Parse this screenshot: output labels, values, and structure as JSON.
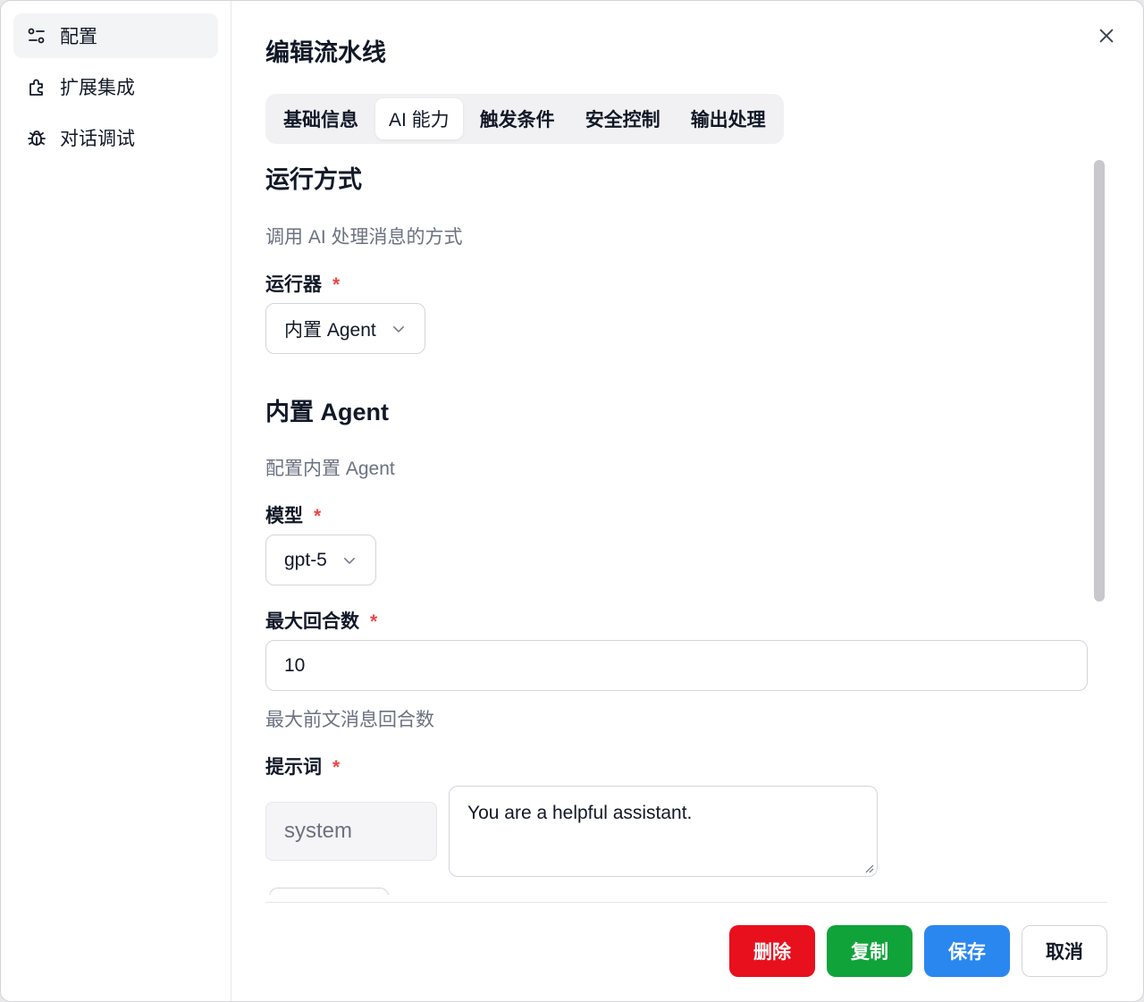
{
  "sidebar": {
    "items": [
      {
        "label": "配置",
        "icon": "settings-sliders-icon",
        "active": true
      },
      {
        "label": "扩展集成",
        "icon": "puzzle-icon",
        "active": false
      },
      {
        "label": "对话调试",
        "icon": "bug-icon",
        "active": false
      }
    ]
  },
  "dialog": {
    "title": "编辑流水线",
    "close_icon": "close-icon"
  },
  "tabs": [
    {
      "label": "基础信息",
      "active": false
    },
    {
      "label": "AI 能力",
      "active": true
    },
    {
      "label": "触发条件",
      "active": false
    },
    {
      "label": "安全控制",
      "active": false
    },
    {
      "label": "输出处理",
      "active": false
    }
  ],
  "run_mode": {
    "title": "运行方式",
    "desc": "调用 AI 处理消息的方式",
    "runner_label": "运行器",
    "runner_required": "*",
    "runner_value": "内置 Agent"
  },
  "agent": {
    "title": "内置 Agent",
    "desc": "配置内置 Agent",
    "model_label": "模型",
    "model_required": "*",
    "model_value": "gpt-5",
    "max_rounds_label": "最大回合数",
    "max_rounds_required": "*",
    "max_rounds_value": "10",
    "max_rounds_hint": "最大前文消息回合数",
    "prompt_label": "提示词",
    "prompt_required": "*",
    "prompt_role": "system",
    "prompt_content": "You are a helpful assistant."
  },
  "footer": {
    "delete_label": "删除",
    "copy_label": "复制",
    "save_label": "保存",
    "cancel_label": "取消"
  },
  "colors": {
    "delete": "#e8101c",
    "copy": "#10a33a",
    "save": "#2b87f0",
    "required": "#ef4444"
  }
}
